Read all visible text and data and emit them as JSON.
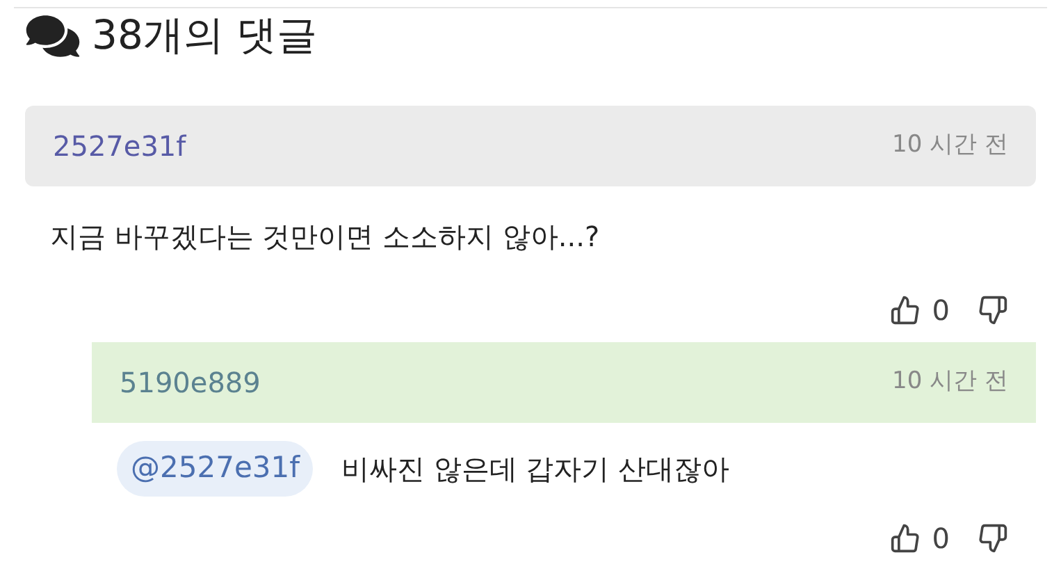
{
  "heading": {
    "title": "38개의 댓글"
  },
  "comments": [
    {
      "author": "2527e31f",
      "time": "10 시간 전",
      "text": "지금 바꾸겠다는 것만이면 소소하지 않아...?",
      "likes": "0",
      "replies": [
        {
          "author": "5190e889",
          "time": "10 시간 전",
          "mention": "@2527e31f",
          "text": "비싸진 않은데 갑자기 산대잖아",
          "likes": "0"
        }
      ]
    }
  ]
}
